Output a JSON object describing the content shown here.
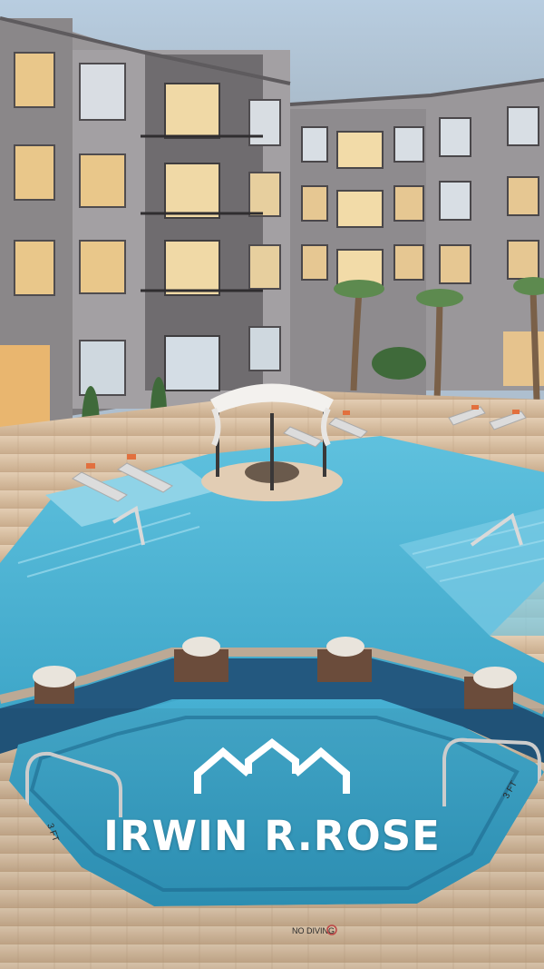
{
  "brand": {
    "name": "IRWIN R.ROSE",
    "logo_icon": "three-house-rooflines-icon",
    "text_color": "#ffffff"
  },
  "background": {
    "description_icon": "apartment-pool-photo",
    "signs": {
      "depth_left": "3 FT",
      "depth_right": "3 FT",
      "no_diving": "NO DIVING"
    }
  },
  "colors": {
    "sky": "#aebfcf",
    "pool_water": "#49b2d2",
    "deck": "#d8c3aa",
    "building": "#8f8c8f"
  }
}
